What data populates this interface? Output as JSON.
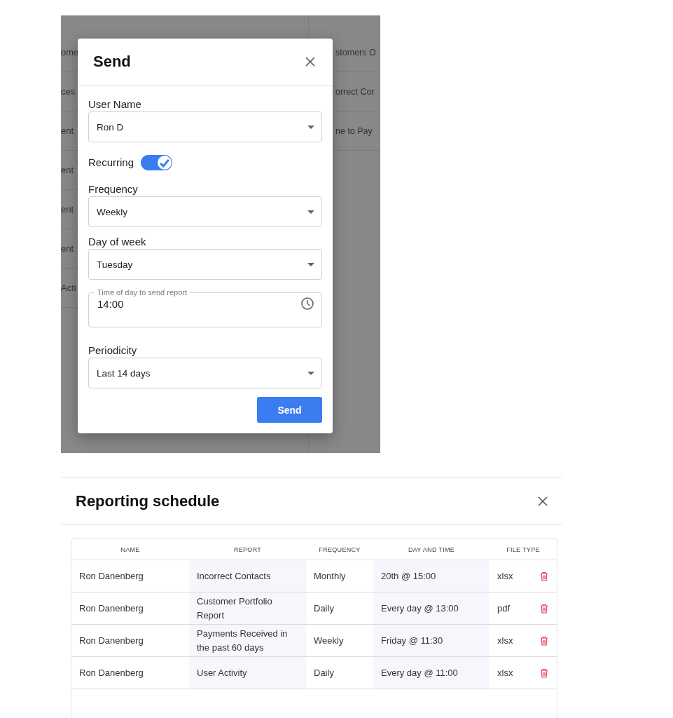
{
  "background_list": {
    "left_items": [
      "ome",
      "ces",
      "ent",
      "ent",
      "ent",
      "ent",
      "Acti"
    ],
    "right_items": [
      "stomers O",
      "orrect Cor",
      "ne to Pay"
    ]
  },
  "send_dialog": {
    "title": "Send",
    "fields": [
      {
        "kind": "select",
        "label": "User Name",
        "value": "Ron D"
      },
      {
        "kind": "toggle",
        "label": "Recurring",
        "on": true
      },
      {
        "kind": "select",
        "label": "Frequency",
        "value": "Weekly"
      },
      {
        "kind": "select",
        "label": "Day of week",
        "value": "Tuesday"
      },
      {
        "kind": "time",
        "label": "Time of day to send report",
        "value": "14:00"
      },
      {
        "kind": "select",
        "label": "Periodicity",
        "value": "Last 14 days"
      }
    ],
    "submit_button": "Send"
  },
  "reporting_schedule": {
    "title": "Reporting schedule",
    "table": {
      "columns": [
        "NAME",
        "REPORT",
        "FREQUENCY",
        "DAY AND TIME",
        "FILE TYPE"
      ],
      "rows": [
        {
          "cells": [
            "Ron Danenberg",
            "Incorrect Contacts",
            "Monthly",
            "20th @ 15:00",
            "xlsx"
          ]
        },
        {
          "cells": [
            "Ron Danenberg",
            "Customer Portfolio Report",
            "Daily",
            "Every day @ 13:00",
            "pdf"
          ]
        },
        {
          "cells": [
            "Ron Danenberg",
            "Payments Received in the past 60 days",
            "Weekly",
            "Friday @ 11:30",
            "xlsx"
          ]
        },
        {
          "cells": [
            "Ron Danenberg",
            "User Activity",
            "Daily",
            "Every day @ 11:00",
            "xlsx"
          ]
        }
      ]
    }
  }
}
